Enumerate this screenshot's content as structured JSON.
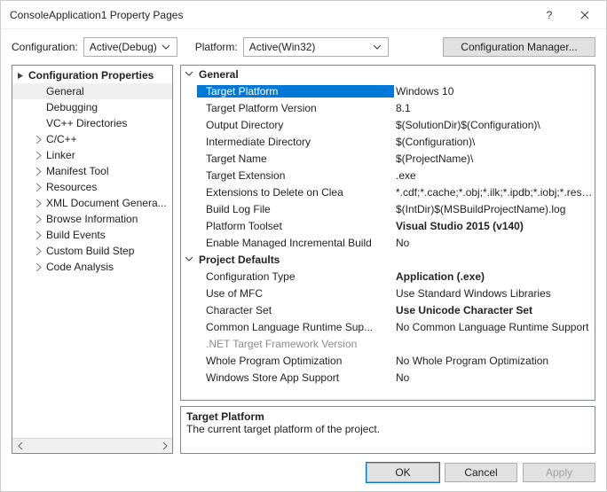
{
  "window": {
    "title": "ConsoleApplication1 Property Pages"
  },
  "configbar": {
    "config_label": "Configuration:",
    "config_value": "Active(Debug)",
    "platform_label": "Platform:",
    "platform_value": "Active(Win32)",
    "manager_label": "Configuration Manager..."
  },
  "tree": {
    "root": "Configuration Properties",
    "items": [
      {
        "label": "General",
        "selected": true,
        "expandable": false
      },
      {
        "label": "Debugging",
        "expandable": false
      },
      {
        "label": "VC++ Directories",
        "expandable": false
      },
      {
        "label": "C/C++",
        "expandable": true
      },
      {
        "label": "Linker",
        "expandable": true
      },
      {
        "label": "Manifest Tool",
        "expandable": true
      },
      {
        "label": "Resources",
        "expandable": true
      },
      {
        "label": "XML Document Genera...",
        "expandable": true
      },
      {
        "label": "Browse Information",
        "expandable": true
      },
      {
        "label": "Build Events",
        "expandable": true
      },
      {
        "label": "Custom Build Step",
        "expandable": true
      },
      {
        "label": "Code Analysis",
        "expandable": true
      }
    ]
  },
  "grid": {
    "cat1": "General",
    "cat2": "Project Defaults",
    "rows1": [
      {
        "name": "Target Platform",
        "value": "Windows 10",
        "selected": true
      },
      {
        "name": "Target Platform Version",
        "value": "8.1"
      },
      {
        "name": "Output Directory",
        "value": "$(SolutionDir)$(Configuration)\\"
      },
      {
        "name": "Intermediate Directory",
        "value": "$(Configuration)\\"
      },
      {
        "name": "Target Name",
        "value": "$(ProjectName)\\"
      },
      {
        "name": "Target Extension",
        "value": ".exe"
      },
      {
        "name": "Extensions to Delete on Clea",
        "value": "*.cdf;*.cache;*.obj;*.ilk;*.ipdb;*.iobj;*.resou..."
      },
      {
        "name": "Build Log File",
        "value": "$(IntDir)$(MSBuildProjectName).log"
      },
      {
        "name": "Platform Toolset",
        "value": "Visual Studio 2015 (v140)",
        "bold": true
      },
      {
        "name": "Enable Managed Incremental Build",
        "value": "No"
      }
    ],
    "rows2": [
      {
        "name": "Configuration Type",
        "value": "Application (.exe)",
        "bold": true
      },
      {
        "name": "Use of MFC",
        "value": "Use Standard Windows Libraries"
      },
      {
        "name": "Character Set",
        "value": "Use Unicode Character Set",
        "bold": true
      },
      {
        "name": "Common Language Runtime Sup...",
        "value": "No Common Language Runtime Support"
      },
      {
        "name": ".NET Target Framework Version",
        "value": "",
        "disabled": true
      },
      {
        "name": "Whole Program Optimization",
        "value": "No Whole Program Optimization"
      },
      {
        "name": "Windows Store App Support",
        "value": "No"
      }
    ]
  },
  "desc": {
    "title": "Target Platform",
    "text": "The current target platform of the project."
  },
  "footer": {
    "ok": "OK",
    "cancel": "Cancel",
    "apply": "Apply"
  }
}
